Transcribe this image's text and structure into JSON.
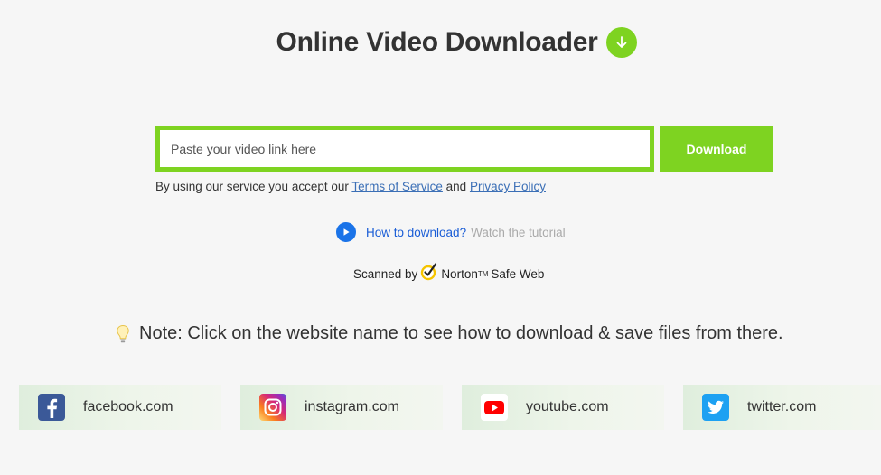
{
  "header": {
    "title": "Online Video Downloader",
    "icon": "arrow-down-circle-icon",
    "accent_color": "#7ed321"
  },
  "search": {
    "placeholder": "Paste your video link here",
    "value": "",
    "button_label": "Download"
  },
  "terms": {
    "prefix": "By using our service you accept our ",
    "tos_label": "Terms of Service",
    "and": " and ",
    "privacy_label": "Privacy Policy"
  },
  "howto": {
    "link_label": "How to download?",
    "suffix": "Watch the tutorial",
    "icon": "play-circle-icon"
  },
  "scanned": {
    "prefix": "Scanned by",
    "brand": "Norton",
    "tm": "TM",
    "suffix": "Safe Web",
    "icon": "norton-check-icon"
  },
  "note": {
    "text": "Note: Click on the website name to see how to download & save files from there.",
    "icon": "lightbulb-icon"
  },
  "sites": [
    {
      "label": "facebook.com",
      "icon": "facebook-icon",
      "color": "#3b5998"
    },
    {
      "label": "instagram.com",
      "icon": "instagram-icon",
      "color": "#c13584"
    },
    {
      "label": "youtube.com",
      "icon": "youtube-icon",
      "color": "#ff0000"
    },
    {
      "label": "twitter.com",
      "icon": "twitter-icon",
      "color": "#1da1f2"
    }
  ]
}
